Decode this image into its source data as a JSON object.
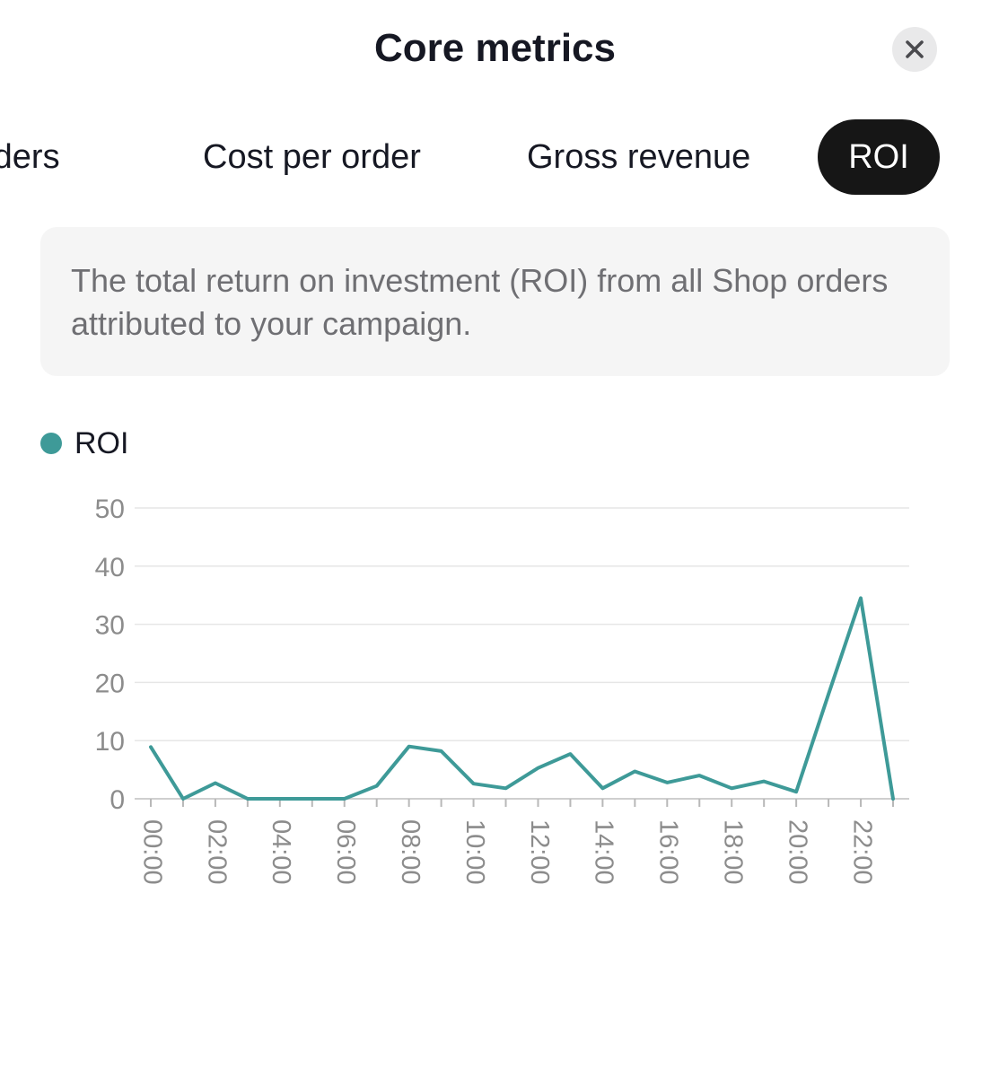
{
  "header": {
    "title": "Core metrics",
    "close_icon": "close-icon"
  },
  "tabs": [
    {
      "label": "rders",
      "active": false
    },
    {
      "label": "Cost per order",
      "active": false
    },
    {
      "label": "Gross revenue",
      "active": false
    },
    {
      "label": "ROI",
      "active": true
    }
  ],
  "description": "The total return on investment (ROI) from all Shop orders attributed to your campaign.",
  "legend": {
    "label": "ROI",
    "color": "#3e9a98"
  },
  "chart_data": {
    "type": "line",
    "title": "",
    "xlabel": "",
    "ylabel": "",
    "ylim": [
      0,
      50
    ],
    "yticks": [
      0,
      10,
      20,
      30,
      40,
      50
    ],
    "x": [
      "00:00",
      "01:00",
      "02:00",
      "03:00",
      "04:00",
      "05:00",
      "06:00",
      "07:00",
      "08:00",
      "09:00",
      "10:00",
      "11:00",
      "12:00",
      "13:00",
      "14:00",
      "15:00",
      "16:00",
      "17:00",
      "18:00",
      "19:00",
      "20:00",
      "21:00",
      "22:00",
      "23:00"
    ],
    "xtick_labels": [
      "00:00",
      "02:00",
      "04:00",
      "06:00",
      "08:00",
      "10:00",
      "12:00",
      "14:00",
      "16:00",
      "18:00",
      "20:00",
      "22:00"
    ],
    "series": [
      {
        "name": "ROI",
        "color": "#3e9a98",
        "values": [
          8.9,
          0,
          2.7,
          0,
          0,
          0,
          0,
          2.2,
          9,
          8.2,
          2.6,
          1.8,
          5.3,
          7.7,
          1.8,
          4.7,
          2.8,
          4.0,
          1.8,
          3.0,
          1.2,
          18.0,
          34.5,
          0
        ]
      }
    ],
    "grid": true,
    "legend_position": "top-left"
  }
}
